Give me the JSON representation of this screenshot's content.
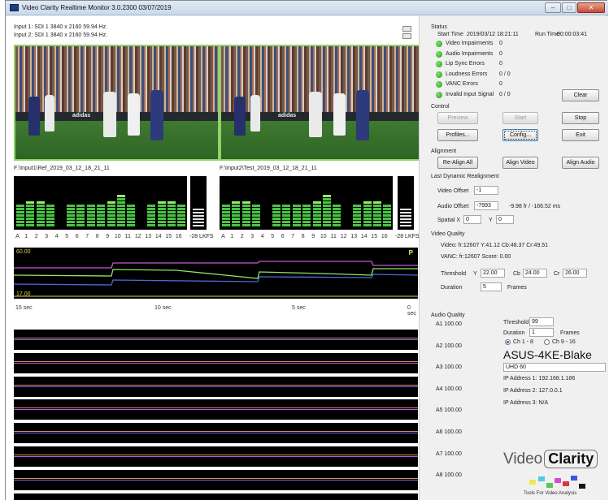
{
  "window": {
    "title": "Video Clarity Realtime Monitor 3.0.2300 03/07/2019",
    "minimize_glyph": "–",
    "maximize_glyph": "□",
    "close_glyph": "✕"
  },
  "inputs": {
    "input1": "Input 1: SDI 1 3840 x 2160 59.94 Hz.",
    "input2": "Input 2: SDI 1 3840 x 2160 59.94 Hz.",
    "path1": "F:\\Input1\\Ref_2019_03_12_18_21_11",
    "path2": "F:\\Input2\\Test_2019_03_12_18_21_11",
    "ad_text": "adidas"
  },
  "audio_meters": {
    "channels": [
      "1",
      "2",
      "3",
      "4",
      "5",
      "6",
      "7",
      "8",
      "9",
      "10",
      "11",
      "12",
      "13",
      "14",
      "15",
      "16"
    ],
    "channel_prefix": "A",
    "lkfs_label": "-28 LKFS",
    "left_levels": [
      0.5,
      0.55,
      0.55,
      0.45,
      0,
      0.45,
      0.45,
      0.45,
      0.45,
      0.55,
      0.7,
      0.45,
      0,
      0.45,
      0.55,
      0.55,
      0.45
    ],
    "right_levels": [
      0.5,
      0.55,
      0.55,
      0.45,
      0,
      0.45,
      0.45,
      0.45,
      0.45,
      0.55,
      0.7,
      0.45,
      0,
      0.45,
      0.55,
      0.55,
      0.45
    ]
  },
  "graph": {
    "top_value": "60.00",
    "bottom_value": "17.00",
    "flag": "P",
    "time_labels": [
      "15 sec",
      "10 sec",
      "5 sec",
      "0 sec"
    ],
    "colors": {
      "magenta": "#c05ad0",
      "green": "#8ee56a",
      "blue": "#4a6bd8",
      "yellow": "#d8d44b"
    }
  },
  "status": {
    "section": "Status",
    "start_time_label": "Start Time",
    "start_time": "2019/03/12 18:21:11",
    "run_time_label": "Run Time",
    "run_time": "00:00:03:41",
    "items": [
      {
        "name": "Video Impairments",
        "value": "0"
      },
      {
        "name": "Audio Impairments",
        "value": "0"
      },
      {
        "name": "Lip Sync Errors",
        "value": "0"
      },
      {
        "name": "Loudness Errors",
        "value": "0 / 0"
      },
      {
        "name": "VANC Errors",
        "value": "0"
      },
      {
        "name": "Invalid Input Signal",
        "value": "0 / 0"
      }
    ],
    "clear_label": "Clear"
  },
  "control": {
    "section": "Control",
    "preview": "Preview",
    "start": "Start",
    "stop": "Stop",
    "profiles": "Profiles...",
    "config": "Config...",
    "exit": "Exit"
  },
  "alignment": {
    "section": "Alignment",
    "realign_all": "Re-Align All",
    "align_video": "Align Video",
    "align_audio": "Align Audio"
  },
  "realignment": {
    "section": "Last Dynamic Realignment",
    "video_offset_label": "Video Offset",
    "video_offset": "-1",
    "audio_offset_label": "Audio Offset",
    "audio_offset": "-7993",
    "audio_offset_note": "-9.98 fr / -166.52 ms",
    "spatial_x_label": "Spatial X",
    "spatial_x": "0",
    "y_label": "Y",
    "spatial_y": "0"
  },
  "video_quality": {
    "section": "Video Quality",
    "video_line": "Video:  fr:12607  Y:41.12  Cb:48.37  Cr:49.51",
    "vanc_line": "VANC:  fr:12607  Score: 0.00",
    "threshold_label": "Threshold",
    "y_label": "Y",
    "y": "22.00",
    "cb_label": "Cb",
    "cb": "24.00",
    "cr_label": "Cr",
    "cr": "26.00",
    "duration_label": "Duration",
    "duration": "5",
    "frames_label": "Frames"
  },
  "audio_quality": {
    "section": "Audio Quality",
    "channels": [
      "A1 100.00",
      "A2 100.00",
      "A3 100.00",
      "A4 100.00",
      "A5 100.00",
      "A6 100.00",
      "A7 100.00",
      "A8 100.00"
    ],
    "threshold_label": "Threshold",
    "threshold": "99",
    "duration_label": "Duration",
    "duration": "1",
    "frames_label": "Frames",
    "radio1": "Ch 1 - 8",
    "radio2": "Ch 9 - 16",
    "host": "ASUS-4KE-Blake",
    "format": "UHD 60",
    "ip1": "IP Address 1: 192.168.1.186",
    "ip2": "IP Address 2: 127.0.0.1",
    "ip3": "IP Address 3: N/A"
  },
  "logo": {
    "word1": "Video",
    "word2": "Clarity",
    "tagline": "Tools For Video Analysis",
    "swatches": [
      "#f3e84a",
      "#50c8e8",
      "#58c854",
      "#d84ad8",
      "#d83a3a",
      "#3a58d8",
      "#151515"
    ]
  }
}
